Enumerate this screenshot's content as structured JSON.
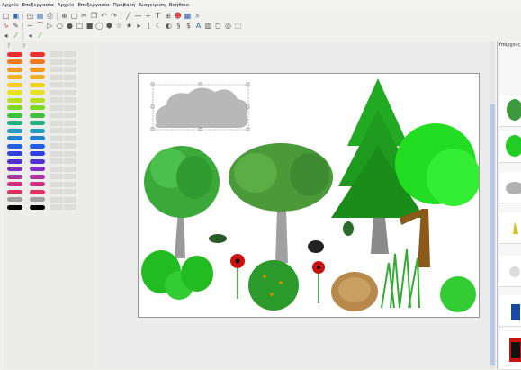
{
  "menu": [
    "Αρχείο",
    "Επεξεργασία",
    "Αρχείο",
    "Επεξεργασία",
    "Προβολή",
    "Διαχείριση",
    "Βοήθεια"
  ],
  "palette": {
    "header_left": "?",
    "header_right": "?",
    "colors": [
      "#f03030",
      "#f07a20",
      "#f09a20",
      "#f0b020",
      "#f0d020",
      "#e8e020",
      "#b8e020",
      "#80d820",
      "#40c040",
      "#20b080",
      "#20a0c0",
      "#2080d0",
      "#2060e0",
      "#3040e0",
      "#5030d0",
      "#8030c0",
      "#b030a0",
      "#d03080",
      "#e03060",
      "#a0a0a0",
      "#000000"
    ]
  },
  "right_panel": {
    "title": "Υπάρχους"
  },
  "accent": "#3b73c8"
}
